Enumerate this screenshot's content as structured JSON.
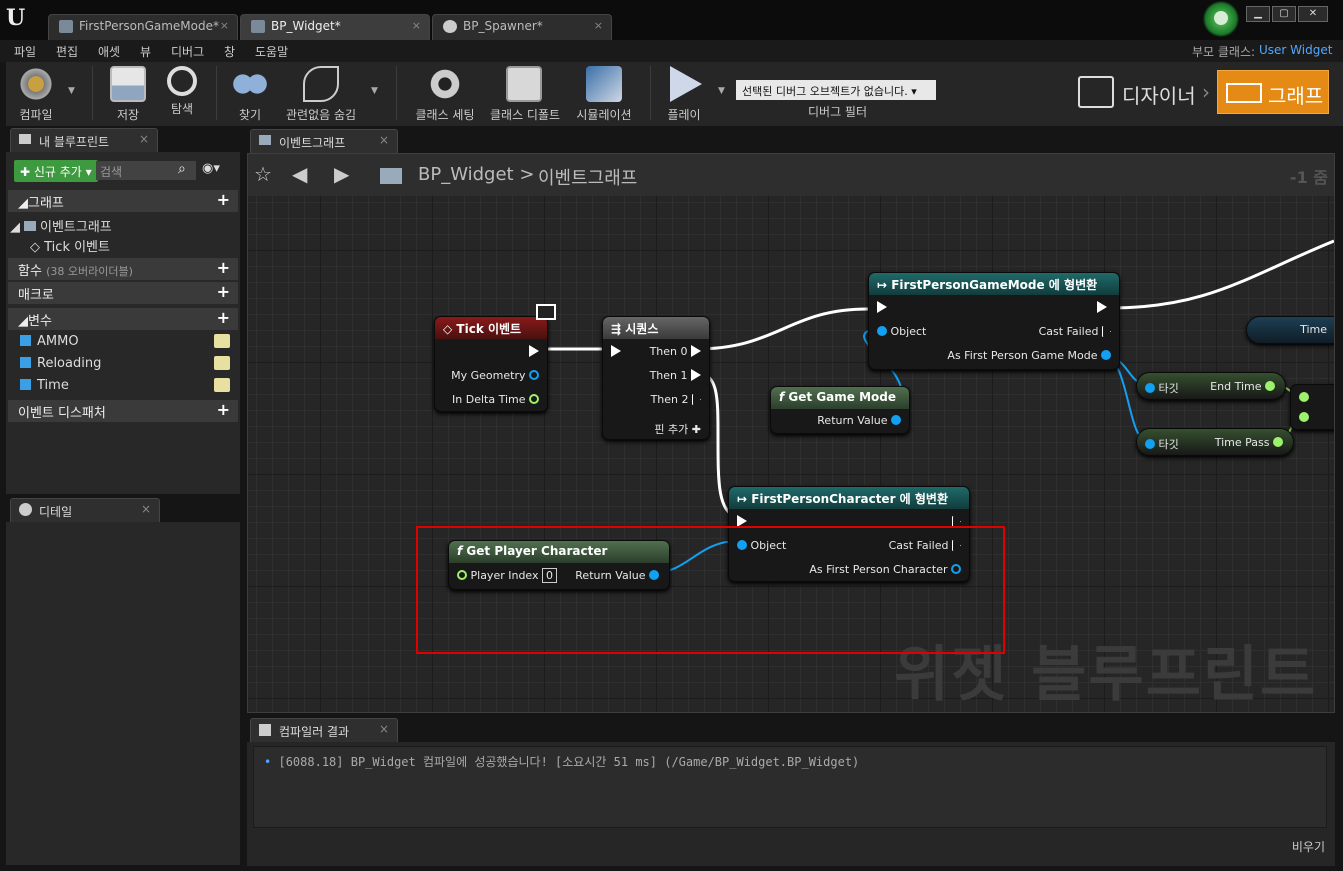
{
  "tabs": [
    {
      "label": "FirstPersonGameMode*",
      "close": "×"
    },
    {
      "label": "BP_Widget*",
      "close": "×"
    },
    {
      "label": "BP_Spawner*",
      "close": "×"
    }
  ],
  "parent_class": {
    "label": "부모 클래스:",
    "value": "User Widget"
  },
  "window_buttons": {
    "min": "▁",
    "max": "▢",
    "close": "✕"
  },
  "menu": [
    "파일",
    "편집",
    "애셋",
    "뷰",
    "디버그",
    "창",
    "도움말"
  ],
  "toolbar": {
    "compile": "컴파일",
    "save": "저장",
    "browse": "탐색",
    "find": "찾기",
    "hide_unrelated": "관련없음 숨김",
    "class_settings": "클래스 세팅",
    "class_defaults": "클래스 디폴트",
    "simulation": "시뮬레이션",
    "play": "플레이",
    "debug_select": "선택된 디버그 오브젝트가 없습니다.",
    "debug_filter": "디버그 필터"
  },
  "mode": {
    "designer": "디자이너",
    "graph": "그래프"
  },
  "my_blueprint": {
    "tab": "내 블루프린트",
    "add_new": "신규 추가",
    "search_placeholder": "검색",
    "graphs": "그래프",
    "event_graph": "이벤트그래프",
    "tick_event": "Tick 이벤트",
    "functions": "함수",
    "functions_sub": "(38 오버라이더블)",
    "macros": "매크로",
    "variables": "변수",
    "vars": [
      "AMMO",
      "Reloading",
      "Time"
    ],
    "dispatchers": "이벤트 디스패처"
  },
  "details": {
    "tab": "디테일"
  },
  "graph": {
    "tab": "이벤트그래프",
    "breadcrumb_root": "BP_Widget",
    "breadcrumb_sep": ">",
    "breadcrumb_graph": "이벤트그래프",
    "zoom": "-1 줌",
    "watermark": "위젯 블루프린트",
    "nodes": {
      "tick": {
        "title": "Tick 이벤트",
        "pins": [
          "My Geometry",
          "In Delta Time"
        ]
      },
      "sequence": {
        "title": "시퀀스",
        "pins": [
          "Then 0",
          "Then 1",
          "Then 2",
          "핀 추가"
        ]
      },
      "cast_gm": {
        "title": "FirstPersonGameMode 에 형변환",
        "pins": [
          "Object",
          "Cast Failed",
          "As First Person Game Mode"
        ]
      },
      "get_gm": {
        "title": "Get Game Mode",
        "pins": [
          "Return Value"
        ]
      },
      "target1": {
        "pins": [
          "타깃",
          "End Time"
        ]
      },
      "target2": {
        "pins": [
          "타깃",
          "Time Pass"
        ]
      },
      "time_var": {
        "title": "Time"
      },
      "get_pc": {
        "title": "Get Player Character",
        "pins": [
          "Player Index",
          "0",
          "Return Value"
        ]
      },
      "cast_fpc": {
        "title": "FirstPersonCharacter 에 형변환",
        "pins": [
          "Object",
          "Cast Failed",
          "As First Person Character"
        ]
      }
    }
  },
  "output": {
    "tab": "컴파일러 결과",
    "bullet": "•",
    "message": "[6088.18] BP_Widget 컴파일에 성공했습니다! [소요시간 51 ms] (/Game/BP_Widget.BP_Widget)",
    "clear": "비우기"
  }
}
